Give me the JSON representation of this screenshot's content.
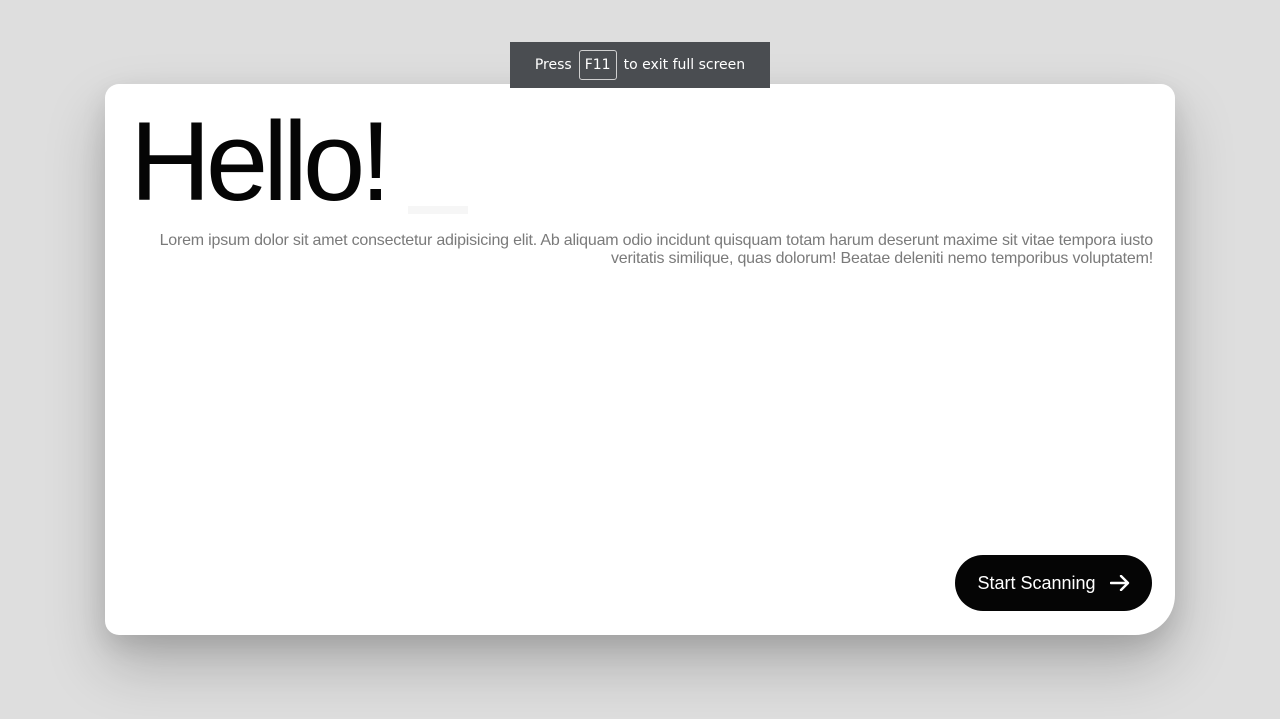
{
  "fullscreen_notice": {
    "prefix": "Press",
    "key": "F11",
    "suffix": "to exit full screen"
  },
  "card": {
    "title": "Hello!",
    "description": "Lorem ipsum dolor sit amet consectetur adipisicing elit. Ab aliquam odio incidunt quisquam totam harum deserunt maxime sit vitae tempora iusto veritatis similique, quas dolorum! Beatae deleniti nemo temporibus voluptatem!",
    "button_label": "Start Scanning",
    "button_icon": "arrow-right-icon"
  },
  "colors": {
    "background": "#dedede",
    "card": "#ffffff",
    "button": "#050505",
    "notice": "#4a4d51",
    "description_text": "#7a7a7a"
  }
}
